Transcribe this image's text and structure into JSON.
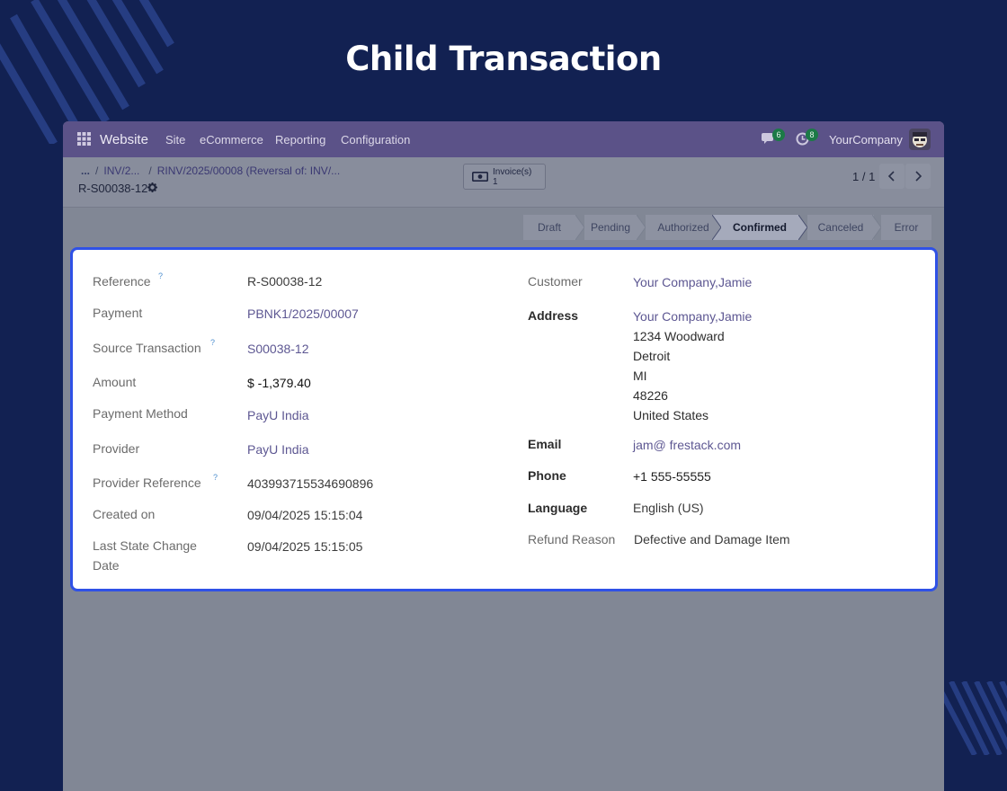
{
  "page_heading": "Child Transaction",
  "colors": {
    "page_background": "#122152",
    "navbar": "#5b5288",
    "card_border": "#2f51e6",
    "link": "#5d5792",
    "badge": "#1c7a47"
  },
  "navbar": {
    "app_name": "Website",
    "apps_icon": "grid-icon",
    "menu": [
      "Site",
      "eCommerce",
      "Reporting",
      "Configuration"
    ],
    "messages_icon": "chat-icon",
    "messages_count": "6",
    "activities_icon": "clock-icon",
    "activities_count": "8",
    "company": "YourCompany",
    "avatar_icon": "avatar"
  },
  "control": {
    "breadcrumb_more": "...",
    "breadcrumb": [
      "INV/2...",
      "RINV/2025/00008 (Reversal of: INV/..."
    ],
    "record_name": "R-S00038-12",
    "gear_icon": "gear-icon",
    "smart_button": {
      "label": "Invoice(s)",
      "count": "1",
      "icon": "money-bill-icon"
    },
    "pager": "1 / 1"
  },
  "statusbar": {
    "stages": [
      "Draft",
      "Pending",
      "Authorized",
      "Confirmed",
      "Canceled",
      "Error"
    ],
    "active": "Confirmed"
  },
  "form": {
    "left": [
      {
        "label": "Reference",
        "help": "?",
        "value": "R-S00038-12",
        "link": false
      },
      {
        "label": "Payment",
        "value": "PBNK1/2025/00007",
        "link": true
      },
      {
        "label": "Source Transaction",
        "help": "?",
        "value": "S00038-12",
        "link": true
      },
      {
        "label": "Amount",
        "value": "$ -1,379.40",
        "link": false
      },
      {
        "label": "Payment Method",
        "value": "PayU India",
        "link": true
      },
      {
        "label": "Provider",
        "value": "PayU India",
        "link": true
      },
      {
        "label": "Provider Reference",
        "help": "?",
        "value": "403993715534690896",
        "link": false
      },
      {
        "label": "Created on",
        "value": "09/04/2025 15:15:04",
        "link": false
      },
      {
        "label": "Last State Change",
        "label_line2": "Date",
        "value": "09/04/2025 15:15:05",
        "link": false
      }
    ],
    "customer_label": "Customer",
    "customer": "Your Company,Jamie",
    "address_label": "Address",
    "address_name": "Your Company,Jamie",
    "address_lines": [
      "1234 Woodward",
      "Detroit",
      "MI",
      "48226",
      "United States"
    ],
    "email_label": "Email",
    "email": "jam@ frestack.com",
    "phone_label": "Phone",
    "phone": "+1 555-55555",
    "language_label": "Language",
    "language": "English (US)",
    "refund_label": "Refund Reason",
    "refund_reason": "Defective and Damage Item"
  }
}
